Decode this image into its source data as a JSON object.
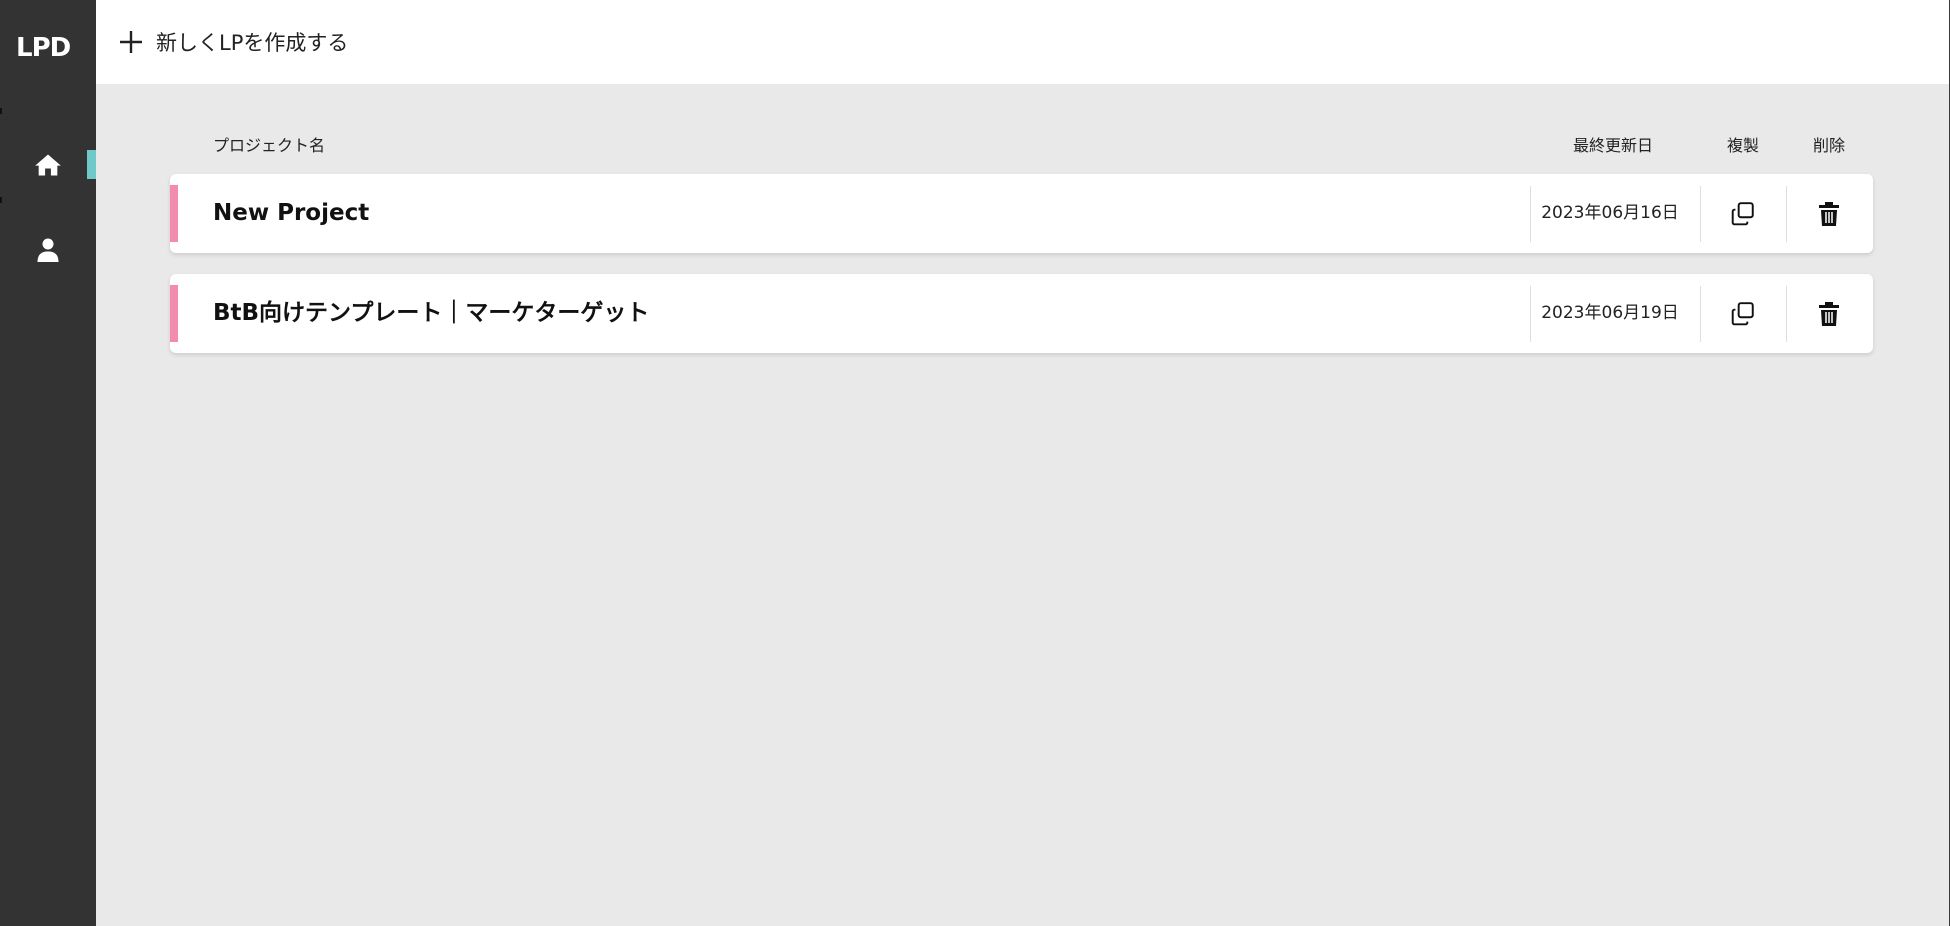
{
  "app": {
    "logo_text": "LPD"
  },
  "sidebar": {
    "items": [
      {
        "name": "home",
        "icon": "home-icon",
        "active": true
      },
      {
        "name": "account",
        "icon": "user-icon",
        "active": false
      }
    ],
    "active_color": "#6fc9c8",
    "background": "#333333"
  },
  "topbar": {
    "create_label": "新しくLPを作成する",
    "create_icon": "plus-icon"
  },
  "table": {
    "headers": {
      "name": "プロジェクト名",
      "updated": "最終更新日",
      "copy": "複製",
      "delete": "削除"
    },
    "rows": [
      {
        "name": "New Project",
        "updated": "2023年06月16日"
      },
      {
        "name": "BtB向けテンプレート｜マーケターゲット",
        "updated": "2023年06月19日"
      }
    ],
    "accent_color": "#f38bb0",
    "row_icons": {
      "copy": "copy-icon",
      "delete": "trash-icon"
    }
  }
}
